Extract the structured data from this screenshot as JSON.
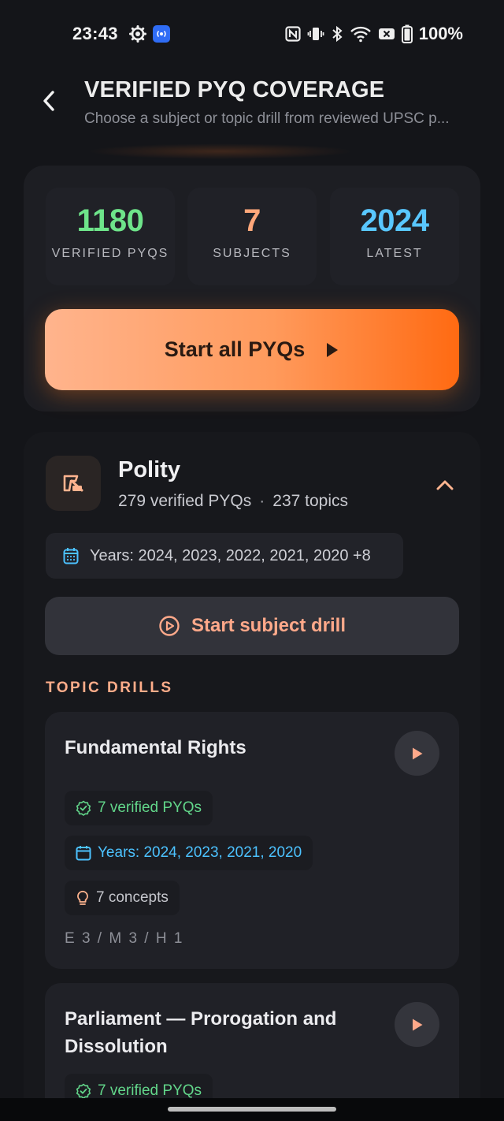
{
  "status_bar": {
    "time": "23:43",
    "battery_text": "100%",
    "left_icons": [
      "gear-icon",
      "broadcast-icon"
    ],
    "right_icons": [
      "nfc-icon",
      "vibrate-icon",
      "bluetooth-icon",
      "wifi-icon",
      "x-box-icon",
      "battery-icon"
    ]
  },
  "header": {
    "title": "VERIFIED PYQ COVERAGE",
    "subtitle": "Choose a subject or topic drill from reviewed UPSC p..."
  },
  "stats": [
    {
      "value": "1180",
      "label": "VERIFIED PYQS",
      "color": "#6ee48a"
    },
    {
      "value": "7",
      "label": "SUBJECTS",
      "color": "#ffa77a"
    },
    {
      "value": "2024",
      "label": "LATEST",
      "color": "#59c7ff"
    }
  ],
  "start_all": {
    "label": "Start all PYQs"
  },
  "subject": {
    "name": "Polity",
    "verified_count": "279 verified PYQs",
    "topics_count": "237 topics",
    "separator": "·",
    "years_label": "Years: 2024, 2023, 2022, 2021, 2020 +8",
    "drill_label": "Start subject drill"
  },
  "topic_drills_heading": "TOPIC DRILLS",
  "topics": [
    {
      "title": "Fundamental Rights",
      "verified": "7 verified PYQs",
      "years": "Years: 2024, 2023, 2021, 2020",
      "concepts": "7 concepts",
      "difficulty": "E 3 / M 3 / H 1"
    },
    {
      "title": "Parliament — Prorogation and Dissolution",
      "verified": "7 verified PYQs"
    }
  ],
  "colors": {
    "accent_orange": "#ff7a1f",
    "accent_peach": "#ffa98a",
    "green": "#62d68a",
    "blue": "#4cc2ff",
    "background": "#141519"
  }
}
